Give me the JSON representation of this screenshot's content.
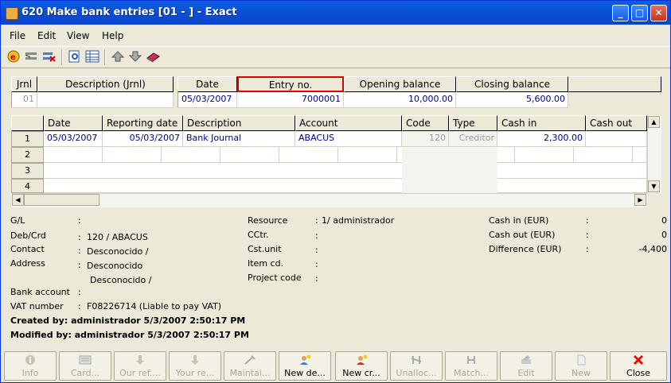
{
  "window": {
    "title": "620 Make bank entries [01 - ] - Exact",
    "min": "_",
    "max": "□",
    "close": "✕"
  },
  "menu": [
    {
      "label": "File"
    },
    {
      "label": "Edit"
    },
    {
      "label": "View"
    },
    {
      "label": "Help"
    }
  ],
  "toolbar_icons": [
    "exact-logo-icon",
    "entry-icon",
    "delete-entry-icon",
    "preview-icon",
    "list-icon",
    "arrow-up-icon",
    "arrow-down-icon",
    "book-icon"
  ],
  "journal": {
    "headers": {
      "jrnl": "Jrnl",
      "description": "Description (Jrnl)"
    },
    "values": {
      "jrnl": "01",
      "description": ""
    }
  },
  "entry_header": {
    "headers": {
      "date": "Date",
      "entry_no": "Entry no.",
      "opening": "Opening balance",
      "closing": "Closing balance"
    },
    "values": {
      "date": "05/03/2007",
      "entry_no": "7000001",
      "opening": "10,000.00",
      "closing": "5,600.00"
    }
  },
  "lines": {
    "columns": {
      "date": "Date",
      "reporting_date": "Reporting date",
      "description": "Description",
      "account": "Account",
      "code": "Code",
      "type": "Type",
      "cash_in": "Cash in",
      "cash_out": "Cash out"
    },
    "row_numbers": [
      "1",
      "2",
      "3",
      "4"
    ],
    "row1": {
      "date": "05/03/2007",
      "reporting_date": "05/03/2007",
      "description": "Bank Journal",
      "account": "ABACUS",
      "code": "120",
      "type": "Creditor",
      "cash_in": "2,300.00",
      "cash_out": ""
    }
  },
  "details": {
    "gl": {
      "label": "G/L",
      "sep": ":",
      "value": ""
    },
    "debcrd": {
      "label": "Deb/Crd",
      "sep": ":",
      "value": "120 / ABACUS"
    },
    "contact": {
      "label": "Contact",
      "sep": ":",
      "value": "Desconocido /"
    },
    "address": {
      "label": "Address",
      "sep": ":",
      "value1": "Desconocido",
      "value2": "Desconocido /"
    },
    "bank": {
      "label": "Bank account",
      "sep": ":",
      "value": ""
    },
    "vat": {
      "label": "VAT number",
      "sep": ":",
      "value": "F08226714 (Liable to pay VAT)"
    },
    "created": "Created by: administrador  5/3/2007 2:50:17 PM",
    "modified": "Modified by: administrador  5/3/2007 2:50:17 PM",
    "resource": {
      "label": "Resource",
      "sep": ":",
      "value": "1/ administrador"
    },
    "cctr": {
      "label": "CCtr.",
      "sep": ":",
      "value": ""
    },
    "cstunit": {
      "label": "Cst.unit",
      "sep": ":",
      "value": ""
    },
    "itemcd": {
      "label": "Item cd.",
      "sep": ":",
      "value": ""
    },
    "project": {
      "label": "Project code",
      "sep": ":",
      "value": ""
    },
    "cashin": {
      "label": "Cash in (EUR)",
      "sep": ":",
      "value": "0"
    },
    "cashout": {
      "label": "Cash out (EUR)",
      "sep": ":",
      "value": "0"
    },
    "diff": {
      "label": "Difference (EUR)",
      "sep": ":",
      "value": "-4,400"
    }
  },
  "buttons": [
    {
      "label": "Info",
      "icon": "info-icon",
      "enabled": false
    },
    {
      "label": "Card...",
      "icon": "card-icon",
      "enabled": false
    },
    {
      "label": "Our ref....",
      "icon": "our-ref-icon",
      "enabled": false
    },
    {
      "label": "Your re...",
      "icon": "your-ref-icon",
      "enabled": false
    },
    {
      "label": "Maintai...",
      "icon": "maintain-icon",
      "enabled": false
    },
    {
      "label": "New de...",
      "icon": "new-debtor-icon",
      "enabled": true
    },
    {
      "label": "New cr...",
      "icon": "new-creditor-icon",
      "enabled": true
    },
    {
      "label": "Unalloc...",
      "icon": "unallocated-icon",
      "enabled": false
    },
    {
      "label": "Match...",
      "icon": "match-icon",
      "enabled": false
    },
    {
      "label": "Edit",
      "icon": "edit-icon",
      "enabled": false
    },
    {
      "label": "New",
      "icon": "new-icon",
      "enabled": false
    },
    {
      "label": "Close",
      "icon": "close-icon",
      "enabled": true
    }
  ],
  "colors": {
    "titlebar": "#0a5fe0",
    "value_text": "#00008b",
    "selected_border": "#e00000",
    "disabled_text": "#aca899"
  }
}
